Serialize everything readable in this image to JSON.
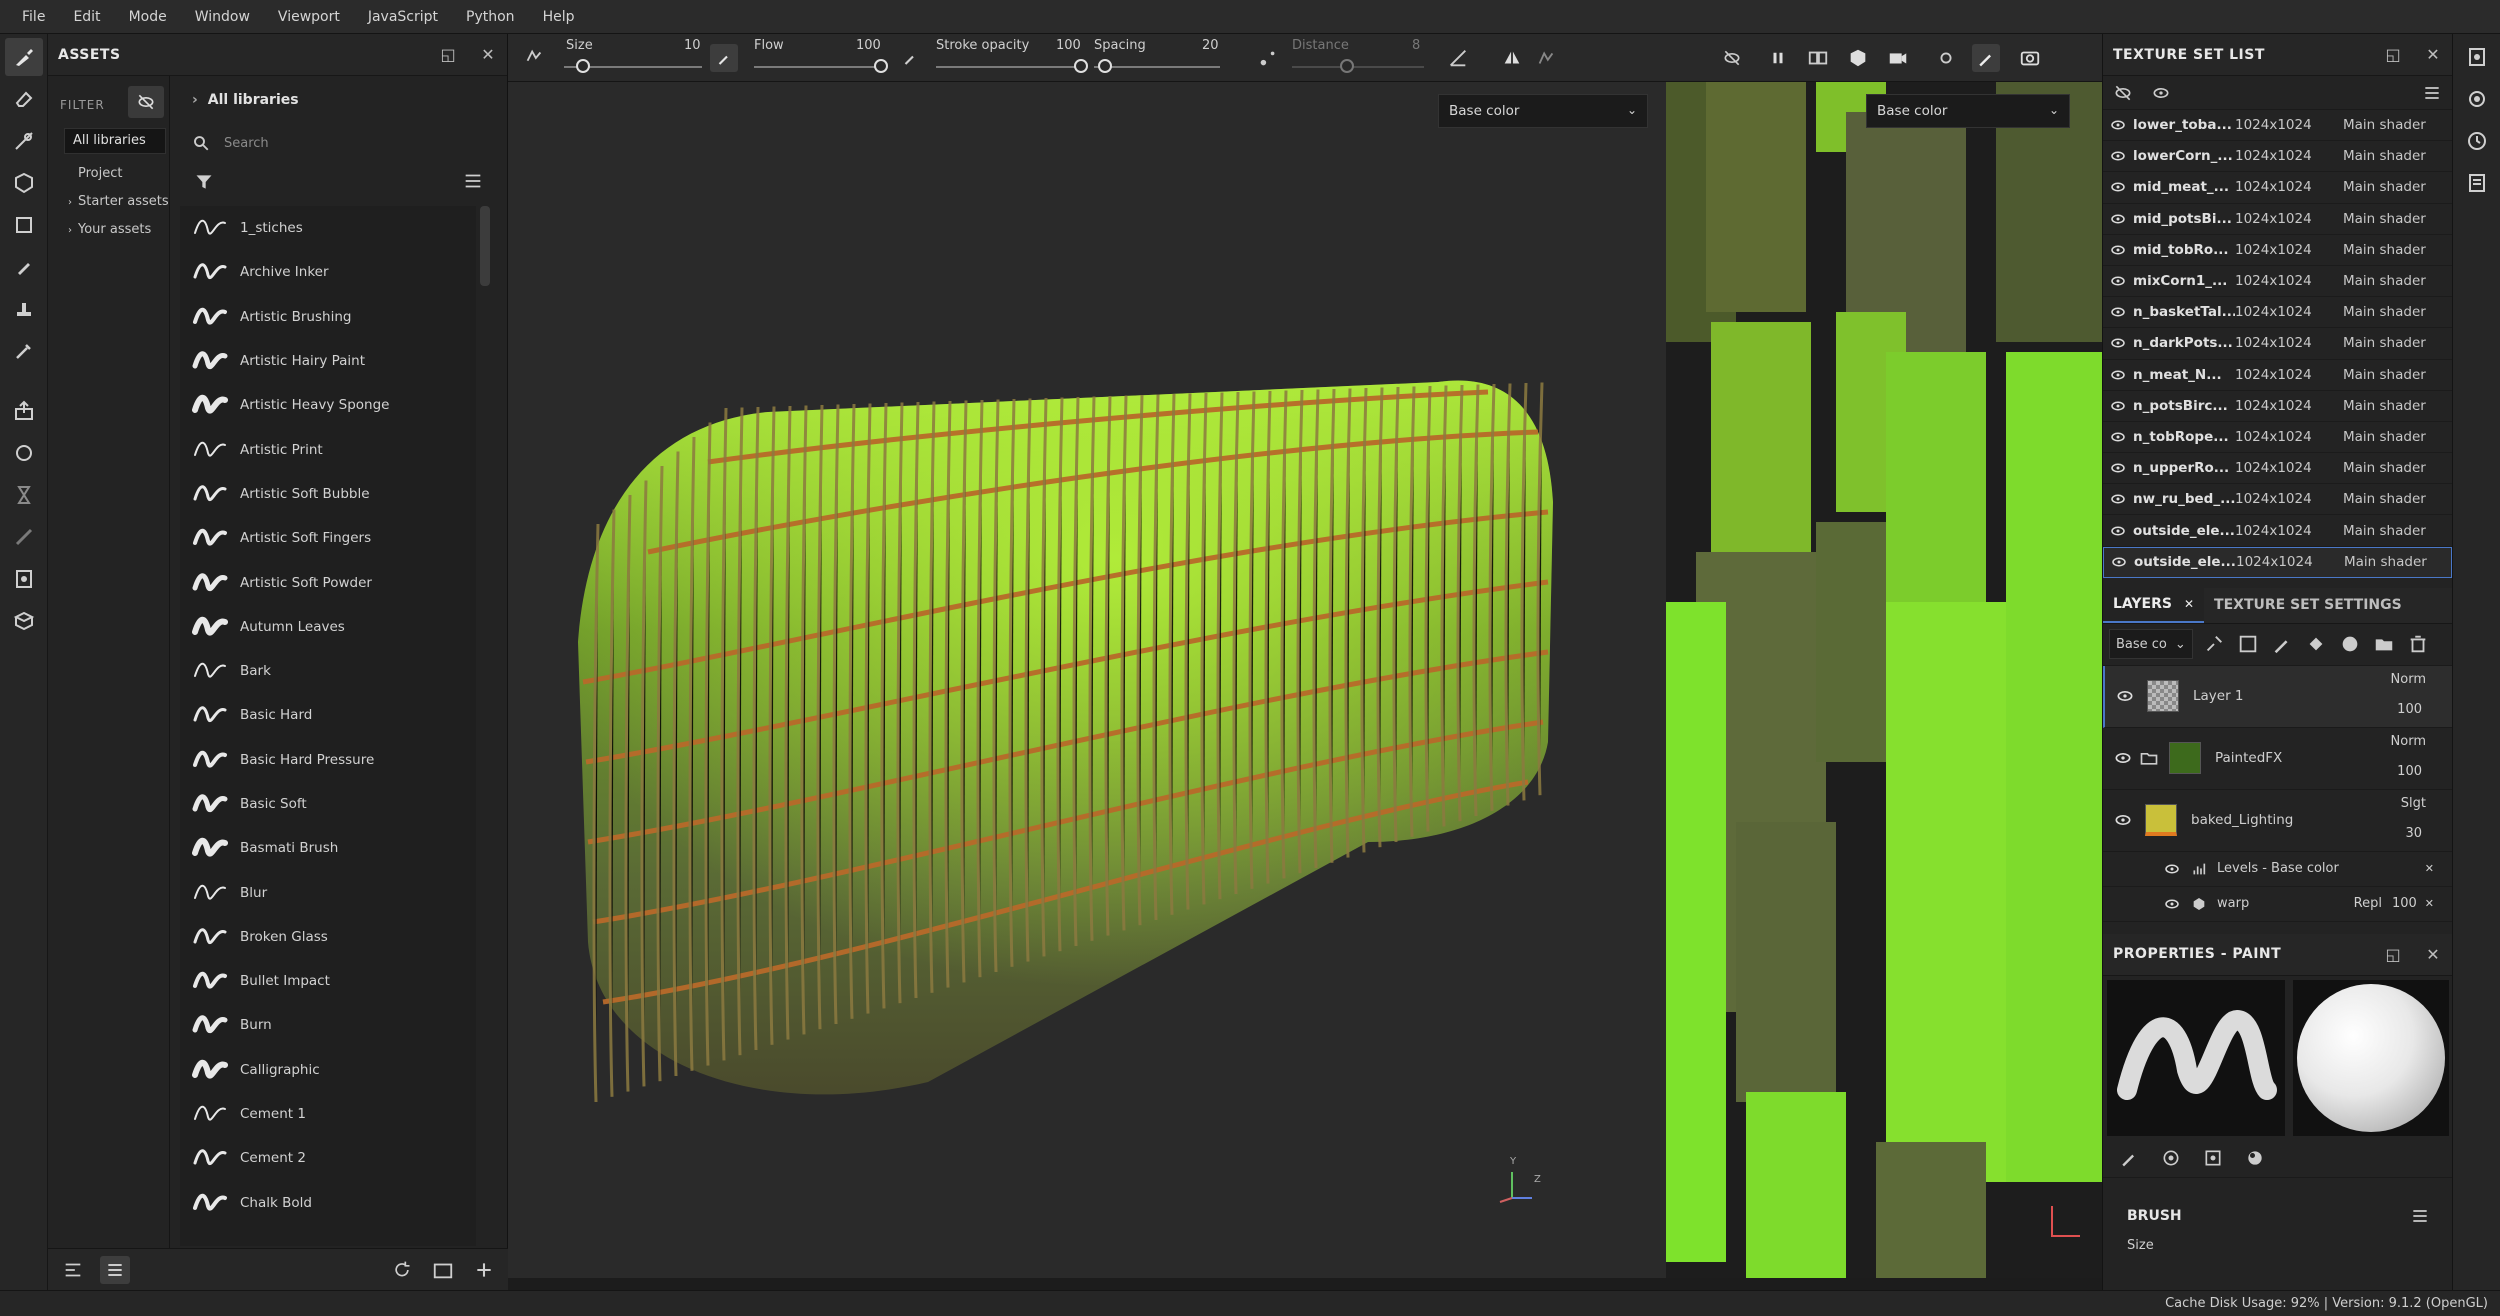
{
  "menu": [
    "File",
    "Edit",
    "Mode",
    "Window",
    "Viewport",
    "JavaScript",
    "Python",
    "Help"
  ],
  "assets": {
    "title": "ASSETS",
    "filter_label": "FILTER",
    "filters": [
      "All libraries",
      "Project",
      "Starter assets",
      "Your assets"
    ],
    "library_title": "All libraries",
    "search_placeholder": "Search",
    "brushes": [
      "1_stiches",
      "Archive Inker",
      "Artistic Brushing",
      "Artistic Hairy Paint",
      "Artistic Heavy Sponge",
      "Artistic Print",
      "Artistic Soft Bubble",
      "Artistic Soft Fingers",
      "Artistic Soft Powder",
      "Autumn Leaves",
      "Bark",
      "Basic Hard",
      "Basic Hard Pressure",
      "Basic Soft",
      "Basmati Brush",
      "Blur",
      "Broken Glass",
      "Bullet Impact",
      "Burn",
      "Calligraphic",
      "Cement 1",
      "Cement 2",
      "Chalk Bold"
    ]
  },
  "toolbar": {
    "size_label": "Size",
    "size_value": "10",
    "flow_label": "Flow",
    "flow_value": "100",
    "stroke_opacity_label": "Stroke opacity",
    "stroke_opacity_value": "100",
    "spacing_label": "Spacing",
    "spacing_value": "20",
    "distance_label": "Distance",
    "distance_value": "8"
  },
  "viewport3d": {
    "channel": "Base color",
    "axis_y": "Y",
    "axis_z": "Z"
  },
  "viewport2d": {
    "channel": "Base color"
  },
  "texture_set_list": {
    "title": "TEXTURE SET LIST",
    "rows": [
      {
        "name": "lower_toba...",
        "res": "1024x1024",
        "shader": "Main shader"
      },
      {
        "name": "lowerCorn_...",
        "res": "1024x1024",
        "shader": "Main shader"
      },
      {
        "name": "mid_meat_...",
        "res": "1024x1024",
        "shader": "Main shader"
      },
      {
        "name": "mid_potsBi...",
        "res": "1024x1024",
        "shader": "Main shader"
      },
      {
        "name": "mid_tobRo...",
        "res": "1024x1024",
        "shader": "Main shader"
      },
      {
        "name": "mixCorn1_...",
        "res": "1024x1024",
        "shader": "Main shader"
      },
      {
        "name": "n_basketTal...",
        "res": "1024x1024",
        "shader": "Main shader"
      },
      {
        "name": "n_darkPots...",
        "res": "1024x1024",
        "shader": "Main shader"
      },
      {
        "name": "n_meat_N...",
        "res": "1024x1024",
        "shader": "Main shader"
      },
      {
        "name": "n_potsBirc...",
        "res": "1024x1024",
        "shader": "Main shader"
      },
      {
        "name": "n_tobRope...",
        "res": "1024x1024",
        "shader": "Main shader"
      },
      {
        "name": "n_upperRo...",
        "res": "1024x1024",
        "shader": "Main shader"
      },
      {
        "name": "nw_ru_bed_...",
        "res": "1024x1024",
        "shader": "Main shader"
      },
      {
        "name": "outside_ele...",
        "res": "1024x1024",
        "shader": "Main shader"
      },
      {
        "name": "outside_ele...",
        "res": "1024x1024",
        "shader": "Main shader"
      }
    ]
  },
  "layers": {
    "tab_layers": "LAYERS",
    "tab_settings": "TEXTURE SET SETTINGS",
    "channel": "Base co",
    "items": [
      {
        "name": "Layer 1",
        "blend": "Norm",
        "opacity": "100"
      },
      {
        "name": "PaintedFX",
        "blend": "Norm",
        "opacity": "100"
      },
      {
        "name": "baked_Lighting",
        "blend": "Slgt",
        "opacity": "30"
      }
    ],
    "effects": [
      {
        "name": "Levels - Base color",
        "blend": "",
        "opacity": ""
      },
      {
        "name": "warp",
        "blend": "Repl",
        "opacity": "100"
      }
    ]
  },
  "properties": {
    "title": "PROPERTIES - PAINT",
    "section": "BRUSH",
    "size_label": "Size"
  },
  "status": {
    "text": "Cache Disk Usage:   92% | Version: 9.1.2 (OpenGL)"
  },
  "colors": {
    "accent": "#4a78c8",
    "moss": "#7fd32a"
  }
}
